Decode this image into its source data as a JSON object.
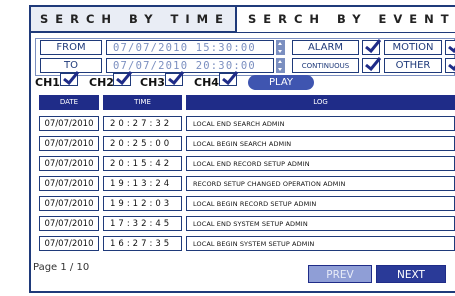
{
  "tabs": {
    "time": "SERCH BY TIME",
    "event": "SERCH BY EVENT"
  },
  "filter": {
    "from_label": "FROM",
    "from_value": "07/07/2010 15:30:00",
    "to_label": "TO",
    "to_value": "07/07/2010 20:30:00",
    "alarm": "ALARM",
    "motion": "MOTION",
    "continuous": "CONTINUOUS",
    "other": "OTHER"
  },
  "channels": {
    "ch1": "CH1",
    "ch2": "CH2",
    "ch3": "CH3",
    "ch4": "CH4",
    "play": "PLAY"
  },
  "table": {
    "headers": {
      "date": "DATE",
      "time": "TIME",
      "log": "LOG"
    },
    "rows": [
      {
        "date": "07/07/2010",
        "time": "20:27:32",
        "log": "LOCAL END SEARCH ADMIN"
      },
      {
        "date": "07/07/2010",
        "time": "20:25:00",
        "log": "LOCAL BEGIN SEARCH ADMIN"
      },
      {
        "date": "07/07/2010",
        "time": "20:15:42",
        "log": "LOCAL END RECORD SETUP ADMIN"
      },
      {
        "date": "07/07/2010",
        "time": "19:13:24",
        "log": "RECORD SETUP CHANGED OPERATION ADMIN"
      },
      {
        "date": "07/07/2010",
        "time": "19:12:03",
        "log": "LOCAL BEGIN RECORD SETUP ADMIN"
      },
      {
        "date": "07/07/2010",
        "time": "17:32:45",
        "log": "LOCAL END SYSTEM SETUP ADMIN"
      },
      {
        "date": "07/07/2010",
        "time": "16:27:35",
        "log": "LOCAL BEGIN SYSTEM SETUP ADMIN"
      }
    ]
  },
  "footer": {
    "page": "Page 1 / 10",
    "prev": "PREV",
    "next": "NEXT"
  },
  "colors": {
    "accent": "#1f2c88",
    "border": "#1f3a7a",
    "light": "#7b8fc0"
  }
}
